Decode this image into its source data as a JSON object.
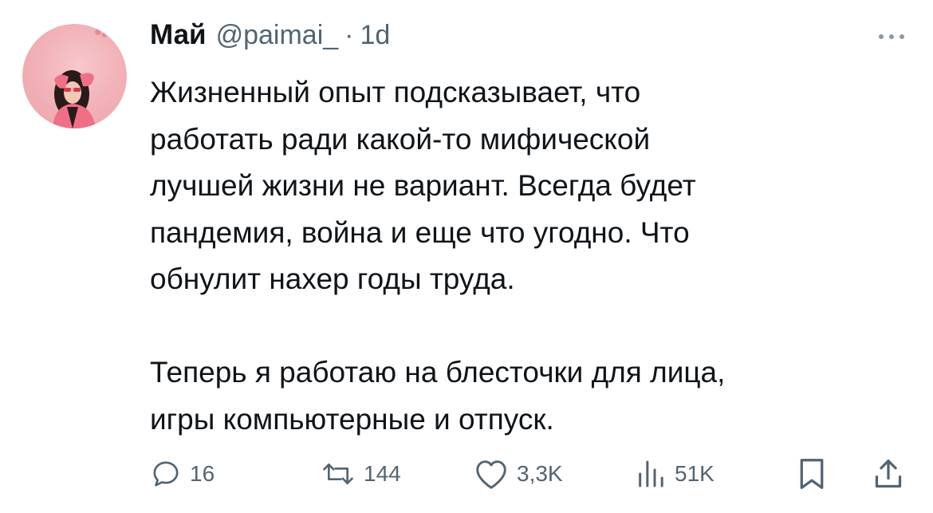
{
  "author": {
    "name": "Май",
    "handle": "@paimai_",
    "separator": "·",
    "time": "1d"
  },
  "tweet": {
    "paragraph1": "Жизненный опыт подсказывает, что\nработать ради какой-то мифической\nлучшей жизни не вариант. Всегда будет\nпандемия, война и еще что угодно. Что\nобнулит нахер годы труда.\n\nТеперь я работаю на блесточки для лица,\nигры компьютерные и отпуск."
  },
  "actions": {
    "replies": "16",
    "retweets": "144",
    "likes": "3,3K",
    "views": "51K"
  },
  "colors": {
    "text_primary": "#0f1419",
    "text_secondary": "#536471",
    "avatar_bg": "#f2b3b8"
  },
  "icons": {
    "reply": "reply-icon",
    "retweet": "retweet-icon",
    "like": "heart-icon",
    "views": "views-icon",
    "bookmark": "bookmark-icon",
    "share": "share-icon",
    "more": "more-icon"
  }
}
